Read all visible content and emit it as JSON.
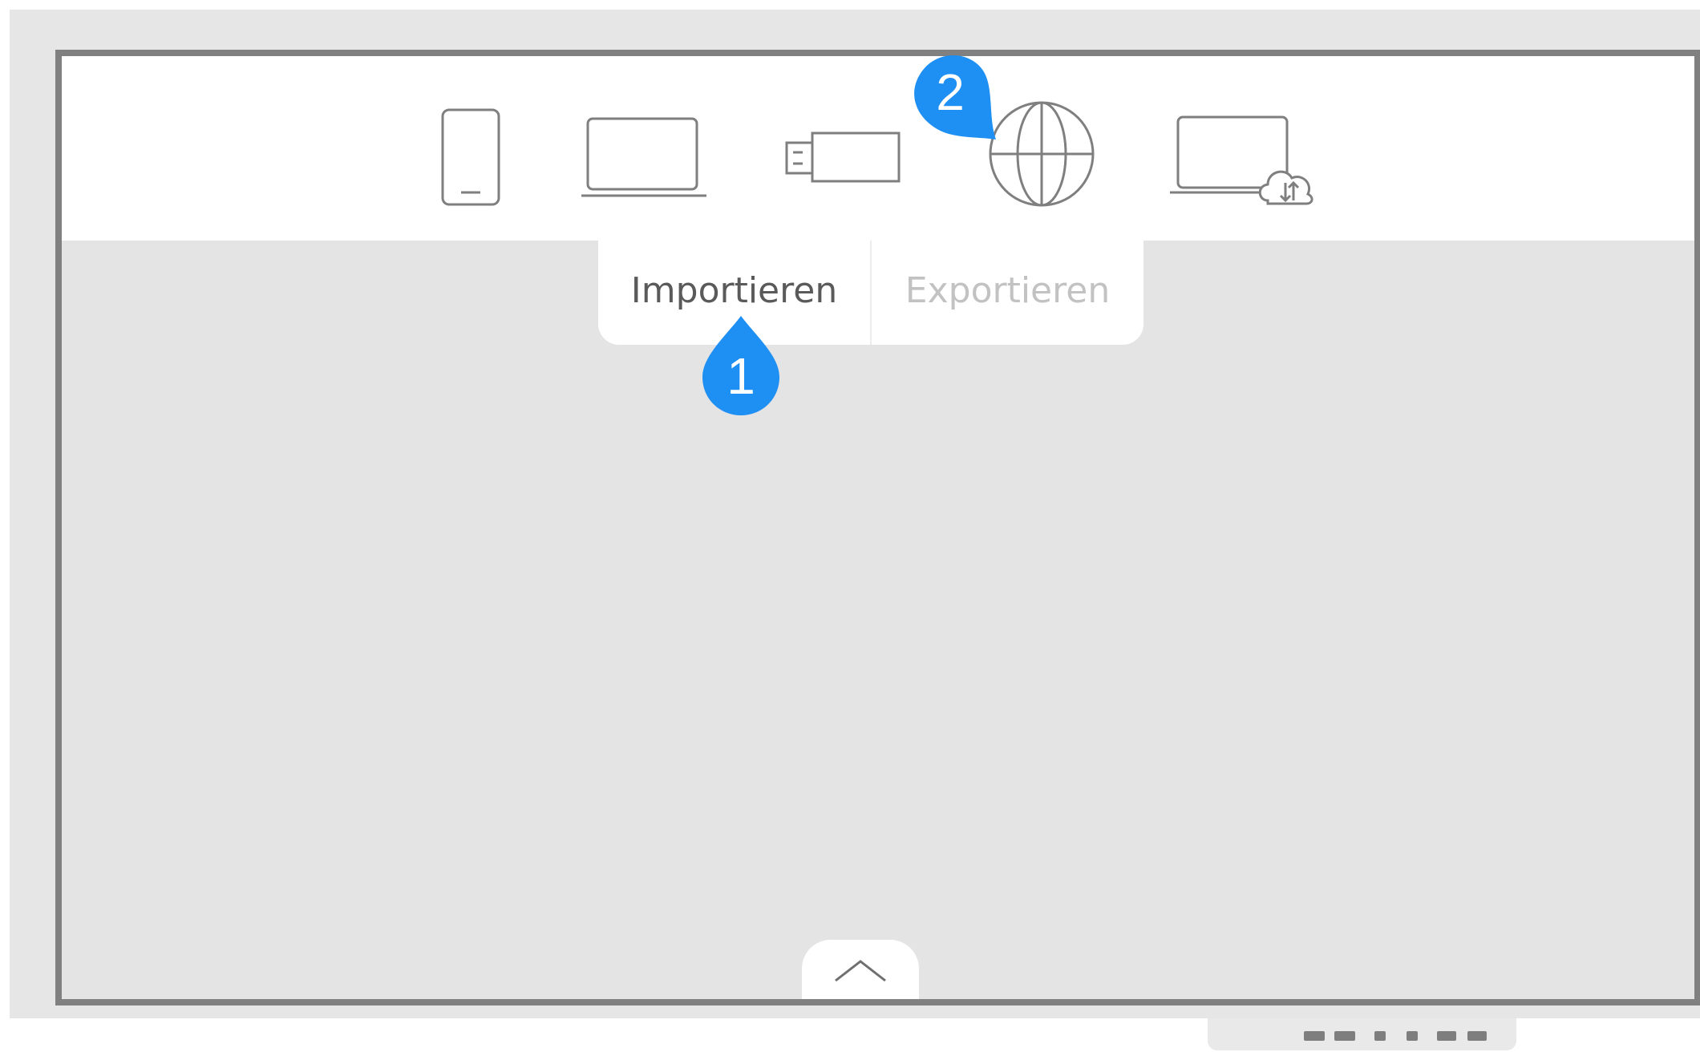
{
  "toolbar": {
    "icons": [
      {
        "name": "mobile-device-icon"
      },
      {
        "name": "laptop-icon"
      },
      {
        "name": "usb-drive-icon"
      },
      {
        "name": "globe-icon"
      },
      {
        "name": "cloud-sync-laptop-icon"
      }
    ]
  },
  "tabs": {
    "import_label": "Importieren",
    "export_label": "Exportieren",
    "active": "import"
  },
  "callouts": {
    "first": "1",
    "second": "2",
    "color": "#1e8ff3"
  },
  "colors": {
    "bezel": "#e6e6e6",
    "frame": "#808080",
    "screen_bg": "#e4e4e4",
    "active_tab_text": "#5a5a5a",
    "inactive_tab_text": "#c2c2c2"
  },
  "bottom_handle": {
    "icon": "chevron-up-icon"
  }
}
